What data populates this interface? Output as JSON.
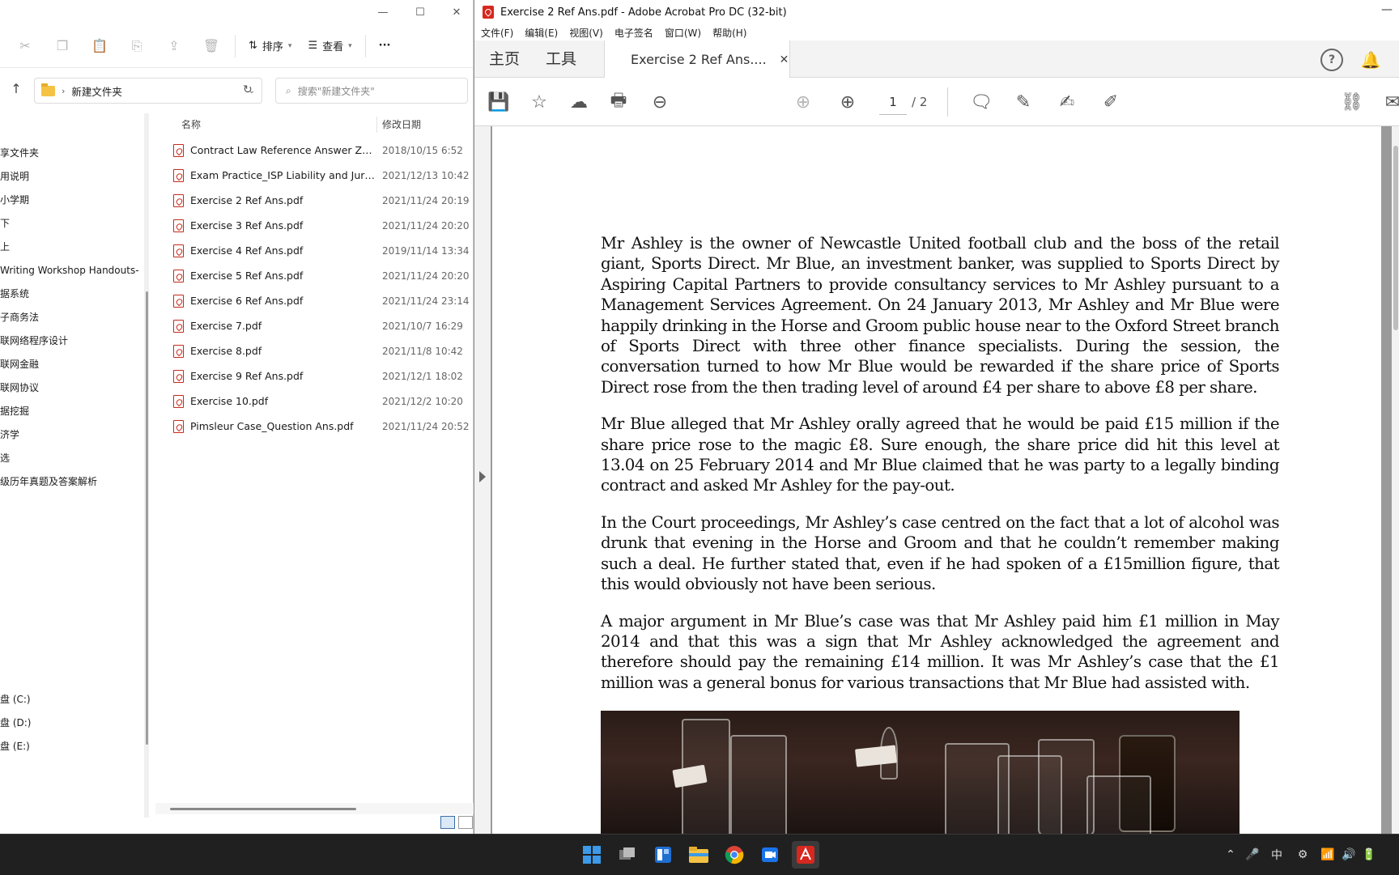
{
  "explorer": {
    "toolbar": {
      "sort_label": "排序",
      "view_label": "查看",
      "more_label": "···"
    },
    "address": {
      "folder": "新建文件夹"
    },
    "search": {
      "placeholder": "搜索\"新建文件夹\""
    },
    "nav_items": [
      "享文件夹",
      "用说明",
      "小学期",
      "下",
      "上",
      "Writing Workshop Handouts-",
      "据系统",
      "子商务法",
      "联网络程序设计",
      "联网金融",
      "联网协议",
      "据挖掘",
      "济学",
      "选",
      "级历年真题及答案解析"
    ],
    "drives": [
      "盘 (C:)",
      "盘 (D:)",
      "盘 (E:)"
    ],
    "columns": {
      "name": "名称",
      "date": "修改日期"
    },
    "files": [
      {
        "name": "Contract Law Reference Answer Zhan...",
        "date": "2018/10/15 6:52"
      },
      {
        "name": "Exam Practice_ISP Liability and Jurisdi...",
        "date": "2021/12/13 10:42"
      },
      {
        "name": "Exercise 2  Ref Ans.pdf",
        "date": "2021/11/24 20:19"
      },
      {
        "name": "Exercise 3  Ref Ans.pdf",
        "date": "2021/11/24 20:20"
      },
      {
        "name": "Exercise 4  Ref Ans.pdf",
        "date": "2019/11/14 13:34"
      },
      {
        "name": "Exercise 5  Ref Ans.pdf",
        "date": "2021/11/24 20:20"
      },
      {
        "name": "Exercise 6  Ref Ans.pdf",
        "date": "2021/11/24 23:14"
      },
      {
        "name": "Exercise 7.pdf",
        "date": "2021/10/7 16:29"
      },
      {
        "name": "Exercise 8.pdf",
        "date": "2021/11/8 10:42"
      },
      {
        "name": "Exercise 9  Ref Ans.pdf",
        "date": "2021/12/1 18:02"
      },
      {
        "name": "Exercise 10.pdf",
        "date": "2021/12/2 10:20"
      },
      {
        "name": "Pimsleur Case_Question  Ans.pdf",
        "date": "2021/11/24 20:52"
      }
    ]
  },
  "acrobat": {
    "title": "Exercise 2  Ref Ans.pdf - Adobe Acrobat Pro DC (32-bit)",
    "menu": [
      "文件(F)",
      "编辑(E)",
      "视图(V)",
      "电子签名",
      "窗口(W)",
      "帮助(H)"
    ],
    "tabs": {
      "home": "主页",
      "tools": "工具",
      "document": "Exercise 2  Ref Ans...."
    },
    "page": {
      "current": "1",
      "total": "/ 2"
    },
    "paragraphs": [
      "Mr Ashley is the owner of Newcastle United football club and the boss of the retail giant, Sports Direct. Mr Blue, an investment banker, was supplied to Sports Direct by Aspiring Capital Partners to provide consultancy services to Mr Ashley pursuant to a Management Services Agreement. On 24 January 2013, Mr Ashley and Mr Blue were happily drinking in the Horse and Groom public house near to the Oxford Street branch of Sports Direct with three other finance specialists. During the session, the conversation turned to how Mr Blue would be rewarded if the share price of Sports Direct rose from the then trading level of around £4 per share to above £8 per share.",
      "Mr Blue alleged that Mr Ashley orally agreed that he would be paid £15 million if the share price rose to the magic £8. Sure enough, the share price did hit this level at 13.04 on 25 February 2014 and Mr Blue claimed that he was party to a legally binding contract and asked Mr Ashley for the pay-out.",
      "In the Court proceedings, Mr Ashley’s case centred on the fact that a lot of alcohol was drunk that evening in the Horse and Groom and that he couldn’t remember making such a deal. He further stated that, even if he had spoken of a £15million figure, that this would obviously not have been serious.",
      "A major argument in Mr Blue’s case was that Mr Ashley paid him £1 million in May 2014 and that this was a sign that Mr Ashley acknowledged the agreement and therefore should pay the remaining £14 million. It was Mr Ashley’s case that the £1 million was a general bonus for various transactions that Mr Blue had assisted with."
    ]
  },
  "taskbar": {
    "ime": "中"
  }
}
